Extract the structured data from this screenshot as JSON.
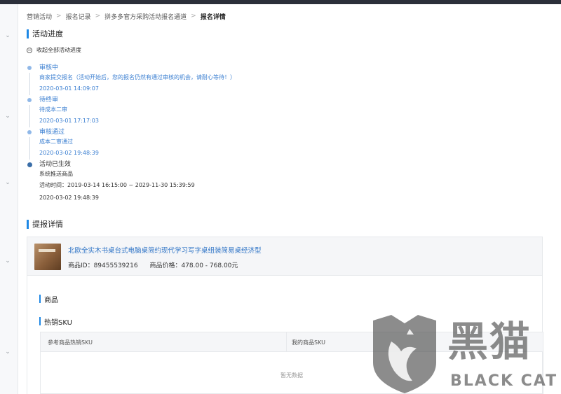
{
  "breadcrumb": {
    "items": [
      "营销活动",
      "报名记录",
      "拼多多官方采购活动报名通道",
      "报名详情"
    ]
  },
  "progress": {
    "title": "活动进度",
    "collapse_label": "收起全部活动进度",
    "steps": [
      {
        "title": "审核中",
        "desc": "商家提交报名（活动开始后，您的报名仍然有通过审核的机会，请耐心等待！）",
        "time": "2020-03-01 14:09:07"
      },
      {
        "title": "待终审",
        "desc": "待成本二审",
        "time": "2020-03-01 17:17:03"
      },
      {
        "title": "审核通过",
        "desc": "成本二审通过",
        "time": "2020-03-02 19:48:39"
      },
      {
        "title": "活动已生效",
        "desc": "系统推送商品",
        "period": "活动时间：2019-03-14 16:15:00 ~ 2029-11-30 15:39:59",
        "time": "2020-03-02 19:48:39"
      }
    ]
  },
  "detail": {
    "title": "提报详情",
    "product": {
      "name": "北欧全实木书桌台式电脑桌简约现代学习写字桌组装简易桌经济型",
      "id_text": "商品ID：89455539216",
      "price_text": "商品价格：478.00 - 768.00元"
    },
    "goods_title": "商品",
    "hot_sku_title": "热销SKU",
    "table": {
      "col1": "参考商品热销SKU",
      "col2": "我的商品SKU",
      "empty": "暂无数据"
    }
  },
  "watermark": {
    "cn": "黑猫",
    "en": "BLACK CAT"
  },
  "colors": {
    "accent": "#1e88e5",
    "link": "#2f74c6",
    "topbar": "#2b2f3a"
  }
}
